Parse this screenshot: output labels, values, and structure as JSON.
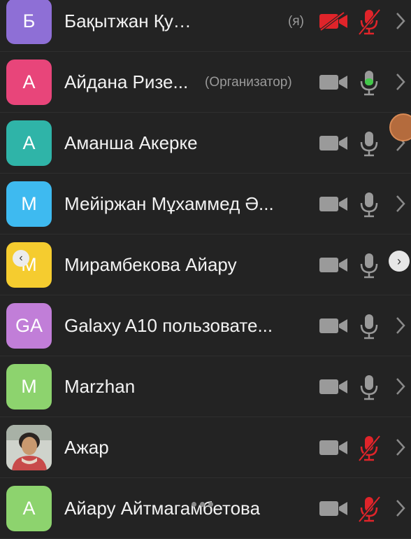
{
  "participants": [
    {
      "initials": "Б",
      "name": "Бақытжан Қуандыққ...",
      "tag": "(я)",
      "avatar_color": "#8e6fd6",
      "camera": "off",
      "mic": "muted"
    },
    {
      "initials": "А",
      "name": "Айдана Ризе...",
      "tag": "(Организатор)",
      "avatar_color": "#e8457a",
      "camera": "idle",
      "mic": "active"
    },
    {
      "initials": "А",
      "name": "Аманша Акерке",
      "tag": "",
      "avatar_color": "#2fb4a8",
      "camera": "idle",
      "mic": "idle"
    },
    {
      "initials": "М",
      "name": "Мейіржан Мұхаммед Ә...",
      "tag": "",
      "avatar_color": "#3ebaf0",
      "camera": "idle",
      "mic": "idle"
    },
    {
      "initials": "М",
      "name": "Мирамбекова Айару",
      "tag": "",
      "avatar_color": "#f5cc2f",
      "camera": "idle",
      "mic": "idle"
    },
    {
      "initials": "GA",
      "name": "Galaxy A10 пользовате...",
      "tag": "",
      "avatar_color": "#c17ed8",
      "camera": "idle",
      "mic": "idle"
    },
    {
      "initials": "M",
      "name": "Marzhan",
      "tag": "",
      "avatar_color": "#8dd36e",
      "camera": "idle",
      "mic": "idle"
    },
    {
      "initials": "",
      "name": "Ажар",
      "tag": "",
      "avatar_color": "#6c6c6c",
      "camera": "idle",
      "mic": "muted",
      "photo": true
    },
    {
      "initials": "А",
      "name": "Айару Айтмагамбетова",
      "tag": "",
      "avatar_color": "#8dd36e",
      "camera": "idle",
      "mic": "muted"
    }
  ],
  "colors": {
    "background": "#232323",
    "icon_idle": "#9a9a9a",
    "icon_muted": "#e0242a",
    "mic_active": "#43c84a"
  }
}
